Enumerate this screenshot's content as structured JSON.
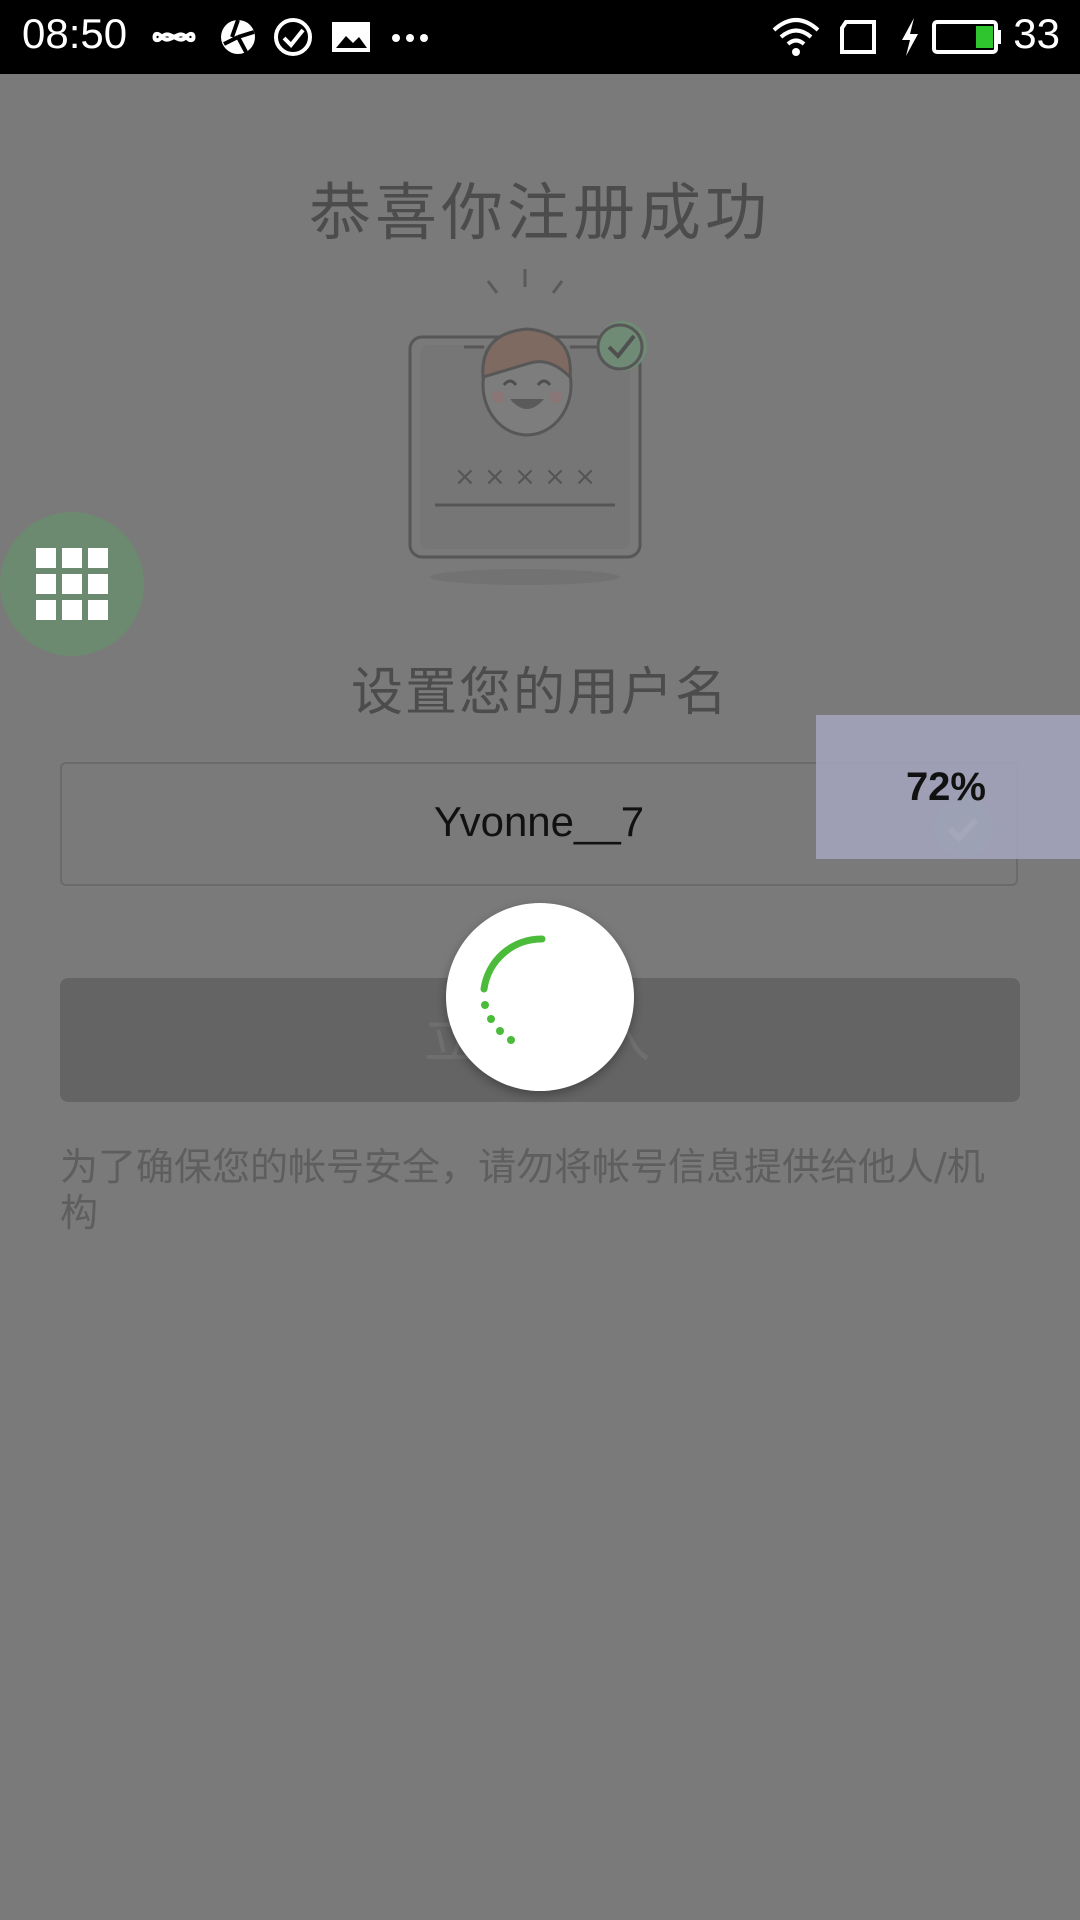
{
  "status_bar": {
    "time": "08:50",
    "battery": "33",
    "left_icons": [
      "infinity-icon",
      "aperture-icon",
      "check-circle-icon",
      "image-icon",
      "more-icon"
    ],
    "right_icons": [
      "wifi-icon",
      "sim-icon",
      "charging-icon",
      "battery-icon"
    ],
    "battery_color": "#2ec52e"
  },
  "page": {
    "title": "恭喜你注册成功",
    "illustration_password": "× × × × ×",
    "subtitle": "设置您的用户名",
    "username": "Yvonne__7",
    "enter_button": "立即进入",
    "notice": "为了确保您的帐号安全，请勿将帐号信息提供给他人/机构"
  },
  "overlay": {
    "progress_percent": "72%",
    "accent_color": "#4cbb3c"
  }
}
